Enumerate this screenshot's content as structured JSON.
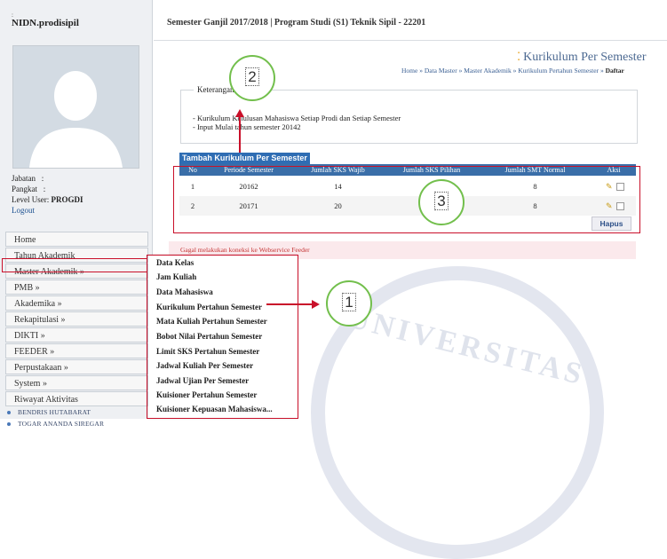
{
  "sidebar": {
    "username": "NIDN.prodisipil",
    "username_tick": ":",
    "jabatan_label": "Jabatan",
    "jabatan_value": ":",
    "pangkat_label": "Pangkat",
    "pangkat_value": ":",
    "level_label": "Level User:",
    "level_value": "PROGDI",
    "logout": "Logout",
    "menu": [
      {
        "label": "Home"
      },
      {
        "label": "Tahun Akademik"
      },
      {
        "label": "Master Akademik »"
      },
      {
        "label": "PMB »"
      },
      {
        "label": "Akademika »"
      },
      {
        "label": "Rekapitulasi »"
      },
      {
        "label": "DIKTI »"
      },
      {
        "label": "FEEDER »"
      },
      {
        "label": "Perpustakaan »"
      },
      {
        "label": "System »"
      },
      {
        "label": "Riwayat Aktivitas"
      }
    ],
    "aktivitas": [
      "BENDRIS HUTABARAT",
      "TOGAR ANANDA SIREGAR"
    ]
  },
  "header": {
    "semester_info": "Semester Ganjil 2017/2018 | Program Studi (S1) Teknik Sipil - 22201"
  },
  "page": {
    "title": "Kurikulum Per Semester",
    "breadcrumb": [
      "Home",
      "Data Master",
      "Master Akademik",
      "Kurikulum Pertahun Semester"
    ],
    "breadcrumb_sep": " » ",
    "breadcrumb_last": "Daftar"
  },
  "keterangan": {
    "legend": "Keterangan",
    "lines": [
      "- Kurikulum Kelulusan Mahasiswa Setiap Prodi dan Setiap Semester",
      "- Input Mulai tahun semester 20142"
    ]
  },
  "table": {
    "add_button": "Tambah Kurikulum Per Semester",
    "headers": [
      "No",
      "Periode Semester",
      "Jumlah SKS Wajib",
      "Jumlah SKS Pilihan",
      "Jumlah SMT Normal",
      "Aksi"
    ],
    "rows": [
      {
        "no": "1",
        "periode": "20162",
        "sks_wajib": "14",
        "sks_pilihan": "",
        "smt_normal": "8"
      },
      {
        "no": "2",
        "periode": "20171",
        "sks_wajib": "20",
        "sks_pilihan": "",
        "smt_normal": "8"
      }
    ],
    "delete_button": "Hapus"
  },
  "error_message": "Gagal melakukan koneksi ke Webservice Feeder",
  "dropdown": [
    "Data Kelas",
    "Jam Kuliah",
    "Data Mahasiswa",
    "Kurikulum Pertahun Semester",
    "Mata Kuliah Pertahun Semester",
    "Bobot Nilai Pertahun Semester",
    "Limit SKS Pertahun Semester",
    "Jadwal Kuliah Per Semester",
    "Jadwal Ujian Per Semester",
    "Kuisioner Pertahun Semester",
    "Kuisioner Kepuasan Mahasiswa..."
  ],
  "annotations": {
    "marker_1": "1",
    "marker_2": "2",
    "marker_3": "3",
    "color_box": "#c9102a",
    "color_circle": "#72bf4c"
  },
  "watermark": "UNIVERSITAS",
  "colors": {
    "accent": "#2f6db3",
    "table_header": "#3a6ea8",
    "error_bg": "#fbe9ec"
  }
}
